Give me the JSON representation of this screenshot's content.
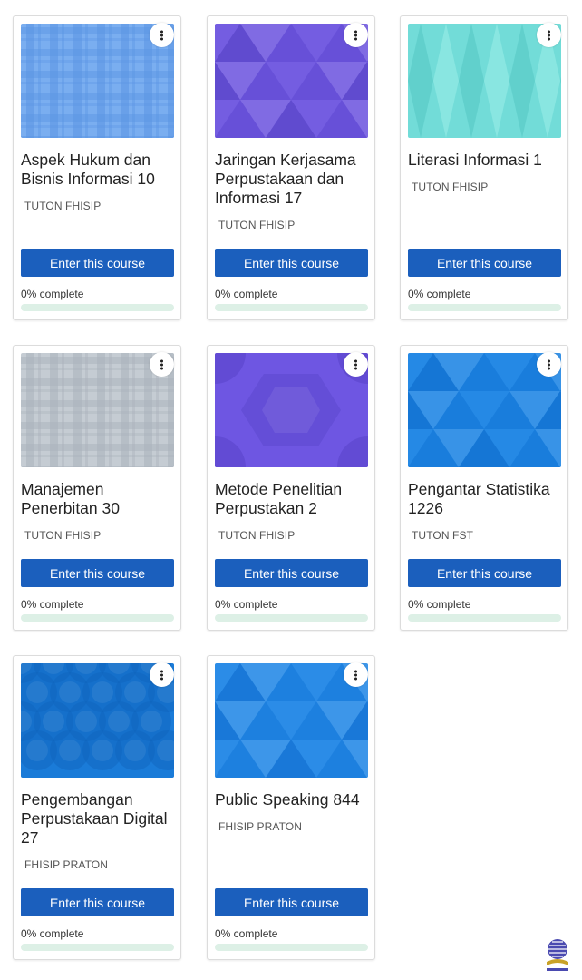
{
  "courses": [
    {
      "title": "Aspek Hukum dan Bisnis Informasi 10",
      "category": "TUTON FHISIP",
      "button": "Enter this course",
      "progress_text": "0% complete",
      "progress": 0,
      "pattern": "plaid",
      "colors": [
        "#7aaef0",
        "#5b95e4"
      ]
    },
    {
      "title": "Jaringan Kerjasama Perpustakaan dan Informasi 17",
      "category": "TUTON FHISIP",
      "button": "Enter this course",
      "progress_text": "0% complete",
      "progress": 0,
      "pattern": "triangles",
      "colors": [
        "#6f57e0",
        "#5a46c8"
      ]
    },
    {
      "title": "Literasi Informasi 1",
      "category": "TUTON FHISIP",
      "button": "Enter this course",
      "progress_text": "0% complete",
      "progress": 0,
      "pattern": "diamonds",
      "colors": [
        "#72dcd8",
        "#5ccdc9"
      ]
    },
    {
      "title": "Manajemen Penerbitan 30",
      "category": "TUTON FHISIP",
      "button": "Enter this course",
      "progress_text": "0% complete",
      "progress": 0,
      "pattern": "plaid",
      "colors": [
        "#c5ccd3",
        "#a9b2bb"
      ]
    },
    {
      "title": "Metode Penelitian Perpustakan 2",
      "category": "TUTON FHISIP",
      "button": "Enter this course",
      "progress_text": "0% complete",
      "progress": 0,
      "pattern": "hexagons",
      "colors": [
        "#6e56e2",
        "#5a45cc"
      ]
    },
    {
      "title": "Pengantar Statistika 1226",
      "category": "TUTON FST",
      "button": "Enter this course",
      "progress_text": "0% complete",
      "progress": 0,
      "pattern": "triangles",
      "colors": [
        "#1d85e4",
        "#136fcf"
      ]
    },
    {
      "title": "Pengembangan Perpustakaan Digital 27",
      "category": "FHISIP PRATON",
      "button": "Enter this course",
      "progress_text": "0% complete",
      "progress": 0,
      "pattern": "circles",
      "colors": [
        "#1a7bd8",
        "#0f64bd"
      ]
    },
    {
      "title": "Public Speaking 844",
      "category": "FHISIP PRATON",
      "button": "Enter this course",
      "progress_text": "0% complete",
      "progress": 0,
      "pattern": "triangles",
      "colors": [
        "#2388e6",
        "#1572d2"
      ]
    }
  ]
}
